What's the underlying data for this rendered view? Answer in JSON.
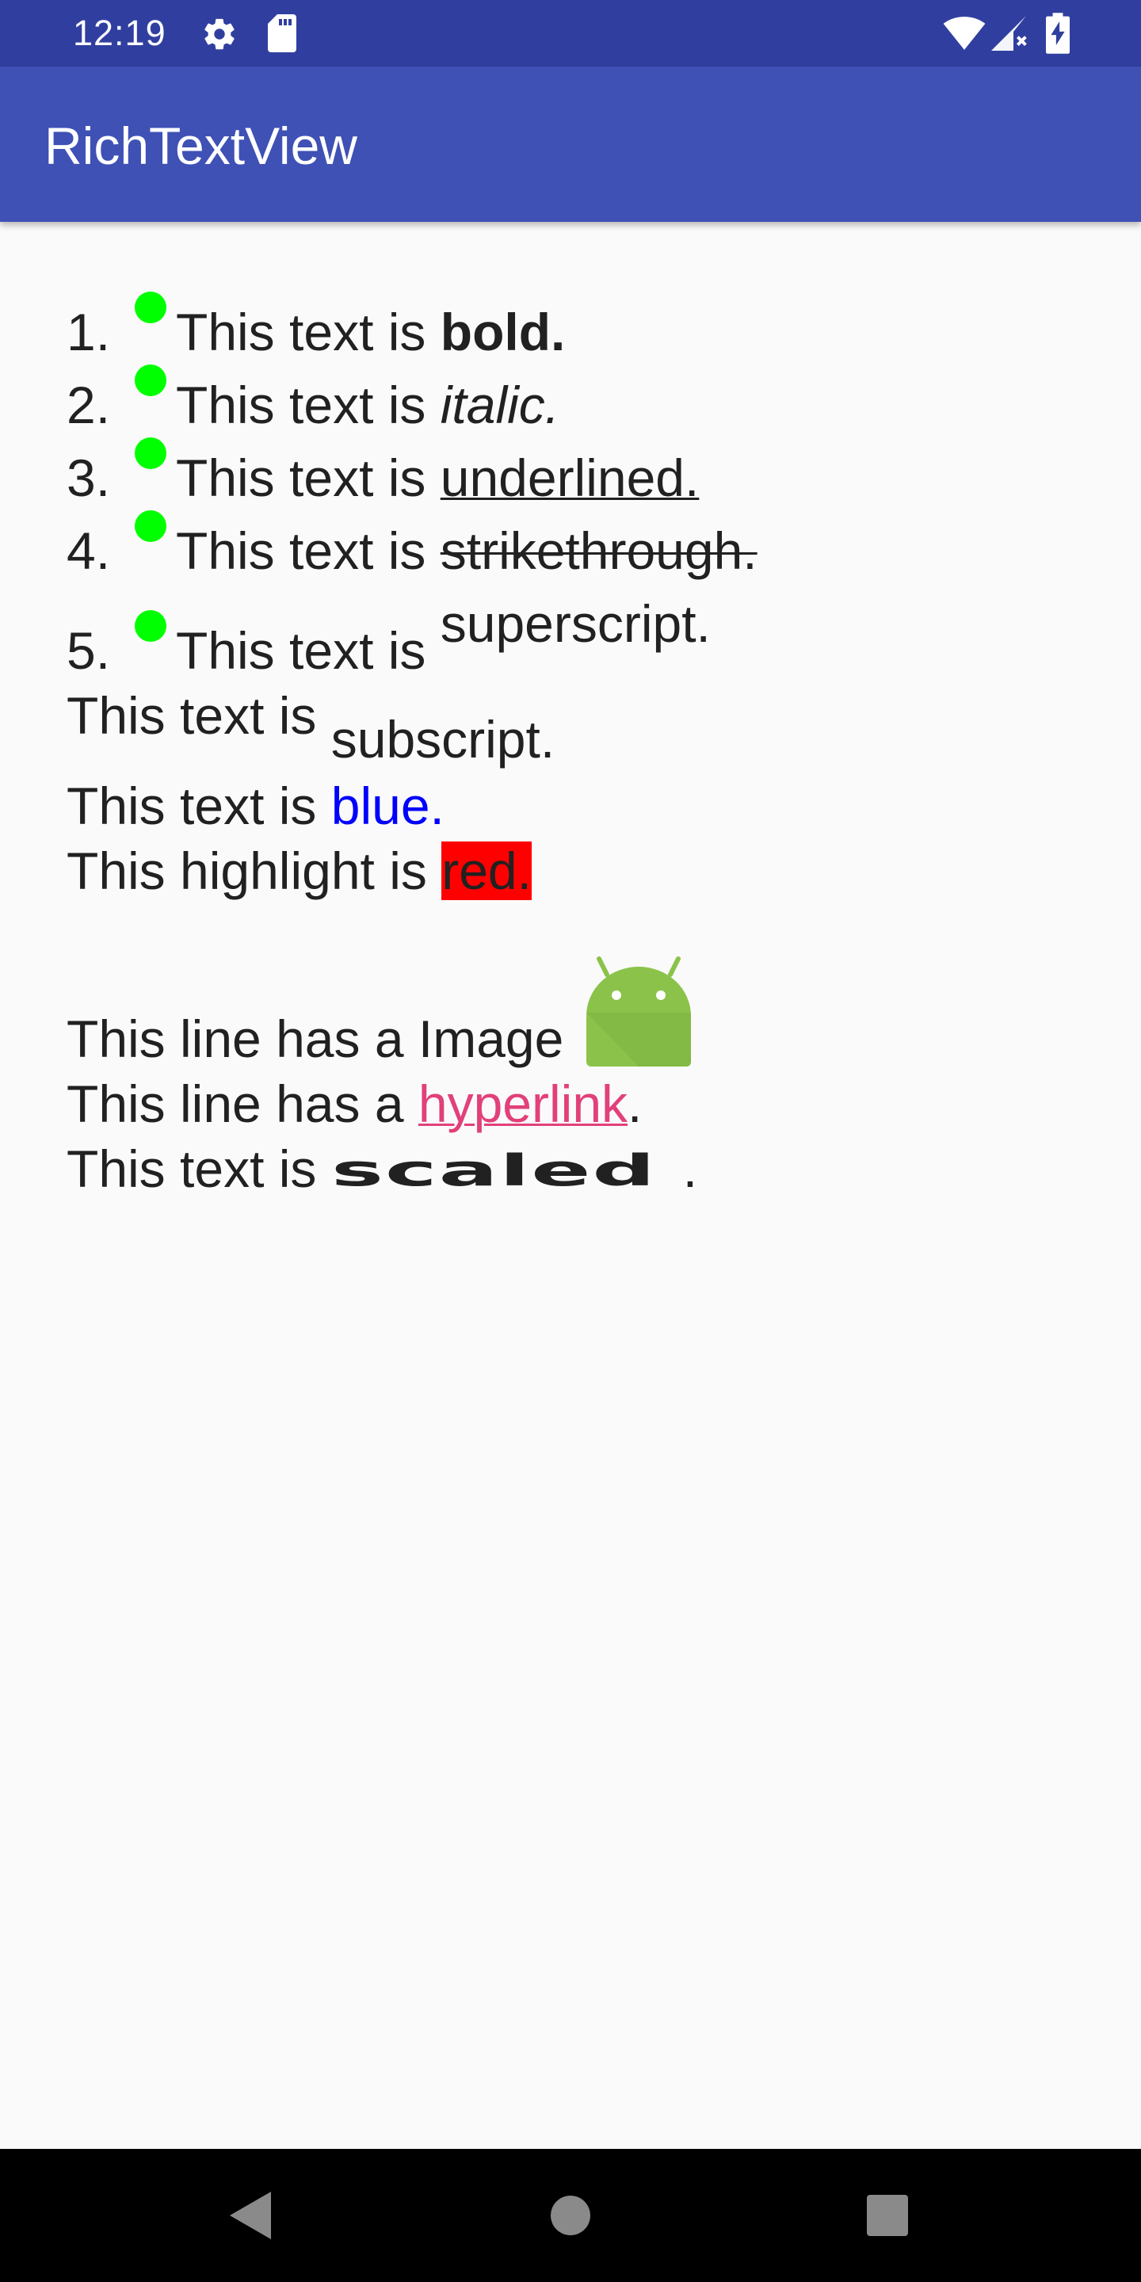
{
  "status_bar": {
    "time": "12:19",
    "icons": [
      "gear-icon",
      "sdcard-icon",
      "wifi-icon",
      "signal-icon",
      "battery-icon"
    ],
    "background": "#303f9f"
  },
  "app_bar": {
    "title": "RichTextView",
    "background": "#3f51b5"
  },
  "content": {
    "list": [
      {
        "number": "1.",
        "prefix": "This text is ",
        "styled": "bold.",
        "style": "bold"
      },
      {
        "number": "2.",
        "prefix": "This text is ",
        "styled": "italic.",
        "style": "italic"
      },
      {
        "number": "3.",
        "prefix": "This text is ",
        "styled": "underlined.",
        "style": "underline"
      },
      {
        "number": "4.",
        "prefix": "This text is ",
        "styled": "strikethrough.",
        "style": "strikethrough"
      },
      {
        "number": "5.",
        "prefix": "This text is ",
        "styled": "superscript.",
        "style": "superscript"
      }
    ],
    "bullet_color": "#00ff00",
    "subscript_line": {
      "prefix": "This text is ",
      "styled": "subscript."
    },
    "blue_line": {
      "prefix": "This text is ",
      "styled": "blue.",
      "color": "#0000ff"
    },
    "highlight_line": {
      "prefix": "This highlight is ",
      "styled": "red.",
      "highlight": "#ff0000"
    },
    "image_line": {
      "prefix": "This line has a Image",
      "image": "android-robot-icon"
    },
    "link_line": {
      "prefix": "This line has a ",
      "link": "hyperlink",
      "suffix": ".",
      "link_color": "#e2407a"
    },
    "scaled_line": {
      "prefix": "This text is ",
      "styled": "scaled",
      "suffix": "."
    }
  },
  "nav_bar": {
    "buttons": [
      "back-icon",
      "home-icon",
      "recents-icon"
    ]
  }
}
